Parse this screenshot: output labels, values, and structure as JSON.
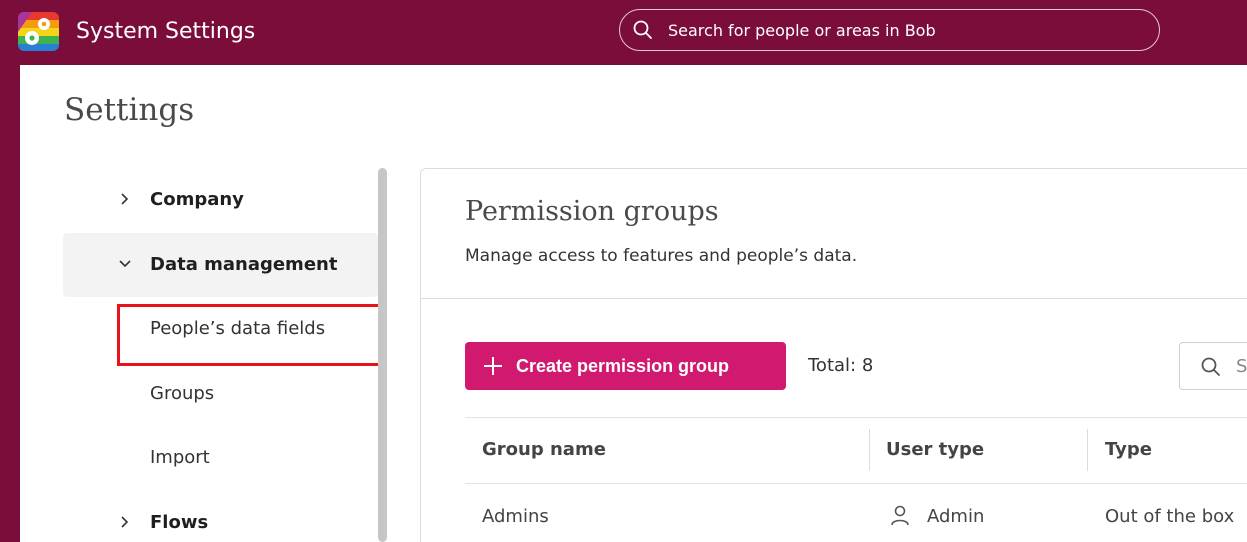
{
  "header": {
    "app_title": "System Settings",
    "search_placeholder": "Search for people or areas in Bob"
  },
  "page": {
    "title": "Settings"
  },
  "sidebar": {
    "items": [
      {
        "label": "Company",
        "expanded": false
      },
      {
        "label": "Data management",
        "expanded": true,
        "children": [
          "People’s data fields",
          "Groups",
          "Import"
        ]
      },
      {
        "label": "Flows",
        "expanded": false
      }
    ]
  },
  "main": {
    "title": "Permission groups",
    "subtitle": "Manage access to features and people’s data.",
    "create_button": "Create permission group",
    "total_label": "Total: 8",
    "search_placeholder_partial": "S",
    "table": {
      "columns": [
        "Group name",
        "User type",
        "Type"
      ],
      "rows": [
        {
          "group_name": "Admins",
          "user_type": "Admin",
          "type": "Out of the box"
        }
      ]
    }
  },
  "colors": {
    "brand": "#7b0d3a",
    "accent": "#d11a6f",
    "highlight": "#e8121a"
  }
}
